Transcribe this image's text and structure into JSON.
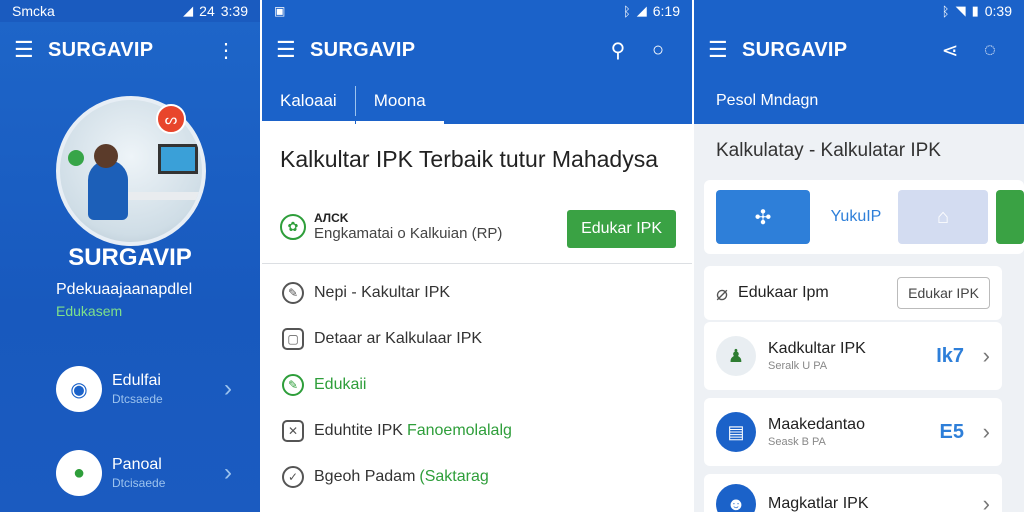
{
  "panel1": {
    "status": {
      "left": "Smcka",
      "time": "3:39",
      "signal": "24"
    },
    "appbar": {
      "title": "SURGAVIP",
      "menu_icon": "menu-icon",
      "more_icon": "more-vert-icon"
    },
    "profile": {
      "name": "SURGAVIP",
      "subtitle": "Pdekuaajaanapdlel",
      "subtitle2": "Edukasem",
      "badge": "ᔕ"
    },
    "items": [
      {
        "label": "Edulfai",
        "sub": "Dtcsaede",
        "icon": "education-icon"
      },
      {
        "label": "Panoal",
        "sub": "Dtcisaede",
        "icon": "panel-icon"
      }
    ]
  },
  "panel2": {
    "status": {
      "time": "6:19"
    },
    "appbar": {
      "title": "SURGAVIP",
      "search_icon": "search-icon",
      "circle_icon": "circle-icon"
    },
    "tabs": [
      {
        "label": "Kaloaai",
        "active": true
      },
      {
        "label": "Moona",
        "active": true
      }
    ],
    "card": {
      "headline": "Kalkultar IPK Terbaik tutur Mahadysa",
      "meta_small": "AЛCK",
      "meta_sub": "Engkamatai o Kalkuian (RP)",
      "button": "Edukar IPK"
    },
    "list": [
      {
        "label": "Nepi - Kakultar IPK",
        "icon": "pencil-icon",
        "style": ""
      },
      {
        "label": "Detaar ar Kalkulaar IPK",
        "icon": "lock-icon",
        "style": ""
      },
      {
        "label": "Edukaii",
        "icon": "edit-icon",
        "style": "green"
      },
      {
        "label": "Eduhtite IPK",
        "highlight": "Fanoemolalalg",
        "icon": "check-box-icon",
        "style": ""
      },
      {
        "label": "Bgeoh Padam",
        "highlight": "(Saktarag",
        "icon": "check-circle-icon",
        "style": ""
      }
    ]
  },
  "panel3": {
    "status": {
      "time": "0:39"
    },
    "appbar": {
      "title": "SURGAVIP",
      "share_icon": "share-icon",
      "chat_icon": "chat-icon"
    },
    "tab": "Pesol Mndagn",
    "heading": "Kalkulatay - Kalkulatar IPK",
    "tiles": [
      {
        "label": "",
        "icon": "tools-icon"
      },
      {
        "label": "YukuIP",
        "icon": ""
      },
      {
        "label": "",
        "icon": "home-icon"
      },
      {
        "label": "",
        "icon": ""
      }
    ],
    "edit_row": {
      "label": "Edukaar Ipm",
      "button": "Edukar IPK",
      "icon": "paperclip-icon"
    },
    "cards": [
      {
        "title": "Kadkultar IPK",
        "sub": "Seralk U PA",
        "num": "Ik7",
        "icon": "person-icon"
      },
      {
        "title": "Maakedantao",
        "sub": "Seask B PA",
        "num": "E5",
        "icon": "dashboard-icon"
      },
      {
        "title": "Magkatlar IPK",
        "sub": "",
        "num": "",
        "icon": "avatar-icon"
      }
    ]
  }
}
